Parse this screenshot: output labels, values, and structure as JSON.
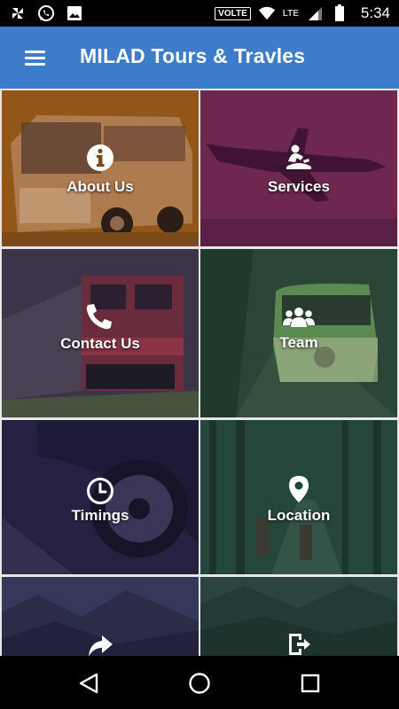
{
  "status_bar": {
    "volte": "VOLTE",
    "network": "LTE",
    "time": "5:34"
  },
  "app_bar": {
    "title": "MILAD Tours & Travles",
    "menu_icon": "hamburger-menu-icon"
  },
  "colors": {
    "app_bar": "#3d7cc8",
    "tile_about": "#9a5a14",
    "tile_services": "#6d2850",
    "tile_contact": "#3a2c48",
    "tile_team": "#284838",
    "tile_timings": "#252040",
    "tile_location": "#23463c"
  },
  "tiles": [
    {
      "id": "about",
      "label": "About Us",
      "icon": "info-icon"
    },
    {
      "id": "services",
      "label": "Services",
      "icon": "concierge-service-icon"
    },
    {
      "id": "contact",
      "label": "Contact Us",
      "icon": "phone-icon"
    },
    {
      "id": "team",
      "label": "Team",
      "icon": "users-icon"
    },
    {
      "id": "timings",
      "label": "Timings",
      "icon": "clock-icon"
    },
    {
      "id": "location",
      "label": "Location",
      "icon": "map-pin-icon"
    },
    {
      "id": "share",
      "label": "",
      "icon": "share-icon"
    },
    {
      "id": "exit",
      "label": "",
      "icon": "exit-icon"
    }
  ],
  "nav_bar": {
    "back_icon": "back-triangle-icon",
    "home_icon": "home-circle-icon",
    "recents_icon": "recents-square-icon"
  }
}
